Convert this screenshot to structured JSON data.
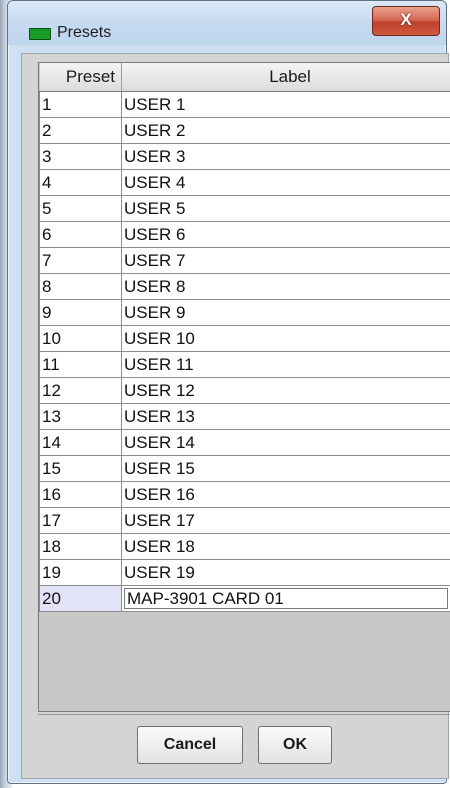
{
  "window": {
    "title": "Presets",
    "close_label": "X"
  },
  "table": {
    "columns": [
      "Preset",
      "Label"
    ],
    "rows": [
      {
        "preset": "1",
        "label": "USER 1"
      },
      {
        "preset": "2",
        "label": "USER 2"
      },
      {
        "preset": "3",
        "label": "USER 3"
      },
      {
        "preset": "4",
        "label": "USER 4"
      },
      {
        "preset": "5",
        "label": "USER 5"
      },
      {
        "preset": "6",
        "label": "USER 6"
      },
      {
        "preset": "7",
        "label": "USER 7"
      },
      {
        "preset": "8",
        "label": "USER 8"
      },
      {
        "preset": "9",
        "label": "USER 9"
      },
      {
        "preset": "10",
        "label": "USER 10"
      },
      {
        "preset": "11",
        "label": "USER 11"
      },
      {
        "preset": "12",
        "label": "USER 12"
      },
      {
        "preset": "13",
        "label": "USER 13"
      },
      {
        "preset": "14",
        "label": "USER 14"
      },
      {
        "preset": "15",
        "label": "USER 15"
      },
      {
        "preset": "16",
        "label": "USER 16"
      },
      {
        "preset": "17",
        "label": "USER 17"
      },
      {
        "preset": "18",
        "label": "USER 18"
      },
      {
        "preset": "19",
        "label": "USER 19"
      },
      {
        "preset": "20",
        "label": "MAP-3901 CARD 01",
        "editing": true
      }
    ]
  },
  "buttons": {
    "cancel_label": "Cancel",
    "ok_label": "OK"
  },
  "colors": {
    "selected_cell": "#e3e3f8",
    "icon_green": "#1a9c2a",
    "close_red": "#c0402b"
  },
  "icons": {
    "app": "green-rect-icon",
    "close": "close-icon"
  }
}
